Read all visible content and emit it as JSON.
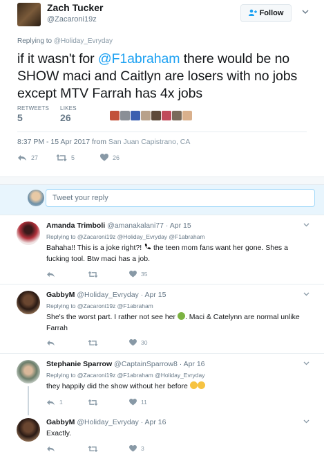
{
  "main_tweet": {
    "name": "Zach Tucker",
    "handle": "@Zacaroni19z",
    "follow_label": "Follow",
    "replying_prefix": "Replying to ",
    "replying_to": "@Holiday_Evryday",
    "text_part1": "if it wasn't for ",
    "mention": "@F1abraham",
    "text_part2": " there would be no SHOW maci and Caitlyn are losers with no jobs except MTV Farrah has 4x jobs",
    "retweets_label": "RETWEETS",
    "retweets_count": "5",
    "likes_label": "LIKES",
    "likes_count": "26",
    "timestamp": "8:37 PM - 15 Apr 2017 from ",
    "location": "San Juan Capistrano, CA",
    "actions": {
      "reply": "27",
      "retweet": "5",
      "like": "26"
    },
    "liker_colors": [
      "#c2513a",
      "#8a8f96",
      "#3b5fb0",
      "#b8a18a",
      "#5e4a3a",
      "#c04a5a",
      "#7a6a5a",
      "#d9b08c"
    ]
  },
  "reply_box": {
    "placeholder": "Tweet your reply"
  },
  "replies": [
    {
      "name": "Amanda Trimboli",
      "meta": "@amanakalani77 · Apr 15",
      "replying": "Replying to @Zacaroni19z @Holiday_Evryday @F1abraham",
      "text_part1": "Bahaha!! This is a joke right?! ",
      "text_part2": " the teen mom fans want her gone. Shes a fucking tool. Btw maci has a job.",
      "emoji": "phone",
      "actions": {
        "reply": "",
        "retweet": "",
        "like": "35"
      }
    },
    {
      "name": "GabbyM",
      "meta": "@Holiday_Evryday · Apr 15",
      "replying": "Replying to @Zacaroni19z @F1abraham",
      "text_part1": "She's the worst part. I rather not see her ",
      "text_part2": ". Maci & Catelynn are normal unlike Farrah",
      "emoji": "nauseated-face",
      "actions": {
        "reply": "",
        "retweet": "",
        "like": "30"
      }
    },
    {
      "name": "Stephanie Sparrow",
      "meta": "@CaptainSparrow8 · Apr 16",
      "replying": "Replying to @Zacaroni19z @F1abraham @Holiday_Evryday",
      "text_part1": "they happily did the show without her before ",
      "text_part2": "",
      "emoji": "tears-of-joy",
      "actions": {
        "reply": "1",
        "retweet": "",
        "like": "11"
      }
    },
    {
      "name": "GabbyM",
      "meta": "@Holiday_Evryday · Apr 16",
      "replying": "",
      "text_part1": "Exactly.",
      "text_part2": "",
      "emoji": "",
      "actions": {
        "reply": "",
        "retweet": "",
        "like": "3"
      }
    }
  ],
  "colors": {
    "accent": "#1da1f2",
    "muted": "#657786",
    "divider": "#e6ecf0",
    "reply_bg": "#e8f5fd"
  }
}
